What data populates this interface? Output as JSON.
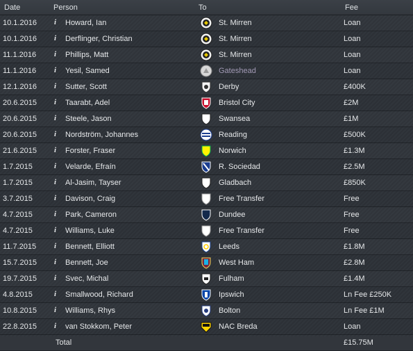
{
  "columns": {
    "date": "Date",
    "person": "Person",
    "to": "To",
    "fee": "Fee"
  },
  "rows": [
    {
      "date": "10.1.2016",
      "person": "Howard, Ian",
      "to": "St. Mirren",
      "fee": "Loan",
      "logo": "st-mirren-crest-icon"
    },
    {
      "date": "10.1.2016",
      "person": "Derflinger, Christian",
      "to": "St. Mirren",
      "fee": "Loan",
      "logo": "st-mirren-crest-icon"
    },
    {
      "date": "11.1.2016",
      "person": "Phillips, Matt",
      "to": "St. Mirren",
      "fee": "Loan",
      "logo": "st-mirren-crest-icon"
    },
    {
      "date": "11.1.2016",
      "person": "Yesil, Samed",
      "to": "Gateshead",
      "fee": "Loan",
      "logo": "gateshead-crest-icon"
    },
    {
      "date": "12.1.2016",
      "person": "Sutter, Scott",
      "to": "Derby",
      "fee": "£400K",
      "logo": "derby-crest-icon"
    },
    {
      "date": "20.6.2015",
      "person": "Taarabt, Adel",
      "to": "Bristol City",
      "fee": "£2M",
      "logo": "bristol-city-crest-icon"
    },
    {
      "date": "20.6.2015",
      "person": "Steele, Jason",
      "to": "Swansea",
      "fee": "£1M",
      "logo": "swansea-crest-icon"
    },
    {
      "date": "20.6.2015",
      "person": "Nordström, Johannes",
      "to": "Reading",
      "fee": "£500K",
      "logo": "reading-crest-icon"
    },
    {
      "date": "21.6.2015",
      "person": "Forster, Fraser",
      "to": "Norwich",
      "fee": "£1.3M",
      "logo": "norwich-crest-icon"
    },
    {
      "date": "1.7.2015",
      "person": "Velarde, Efraín",
      "to": "R. Sociedad",
      "fee": "£2.5M",
      "logo": "real-sociedad-crest-icon"
    },
    {
      "date": "1.7.2015",
      "person": "Al-Jasim, Tayser",
      "to": "Gladbach",
      "fee": "£850K",
      "logo": "gladbach-crest-icon"
    },
    {
      "date": "3.7.2015",
      "person": "Davison, Craig",
      "to": "Free Transfer",
      "fee": "Free",
      "logo": "blank-shield-icon"
    },
    {
      "date": "4.7.2015",
      "person": "Park, Cameron",
      "to": "Dundee",
      "fee": "Free",
      "logo": "dundee-crest-icon"
    },
    {
      "date": "4.7.2015",
      "person": "Williams, Luke",
      "to": "Free Transfer",
      "fee": "Free",
      "logo": "blank-shield-icon"
    },
    {
      "date": "11.7.2015",
      "person": "Bennett, Elliott",
      "to": "Leeds",
      "fee": "£1.8M",
      "logo": "leeds-crest-icon"
    },
    {
      "date": "15.7.2015",
      "person": "Bennett, Joe",
      "to": "West Ham",
      "fee": "£2.8M",
      "logo": "west-ham-crest-icon"
    },
    {
      "date": "19.7.2015",
      "person": "Svec, Michal",
      "to": "Fulham",
      "fee": "£1.4M",
      "logo": "fulham-crest-icon"
    },
    {
      "date": "4.8.2015",
      "person": "Smallwood, Richard",
      "to": "Ipswich",
      "fee": "Ln Fee £250K",
      "logo": "ipswich-crest-icon"
    },
    {
      "date": "10.8.2015",
      "person": "Williams, Rhys",
      "to": "Bolton",
      "fee": "Ln Fee £1M",
      "logo": "bolton-crest-icon"
    },
    {
      "date": "22.8.2015",
      "person": "van Stokkom, Peter",
      "to": "NAC Breda",
      "fee": "Loan",
      "logo": "nac-breda-crest-icon"
    }
  ],
  "total": {
    "label": "Total",
    "fee": "£15.75M"
  },
  "info_glyph": "i",
  "colors": {
    "dim_club": "#a29ab5",
    "text": "#e6e8ea"
  }
}
